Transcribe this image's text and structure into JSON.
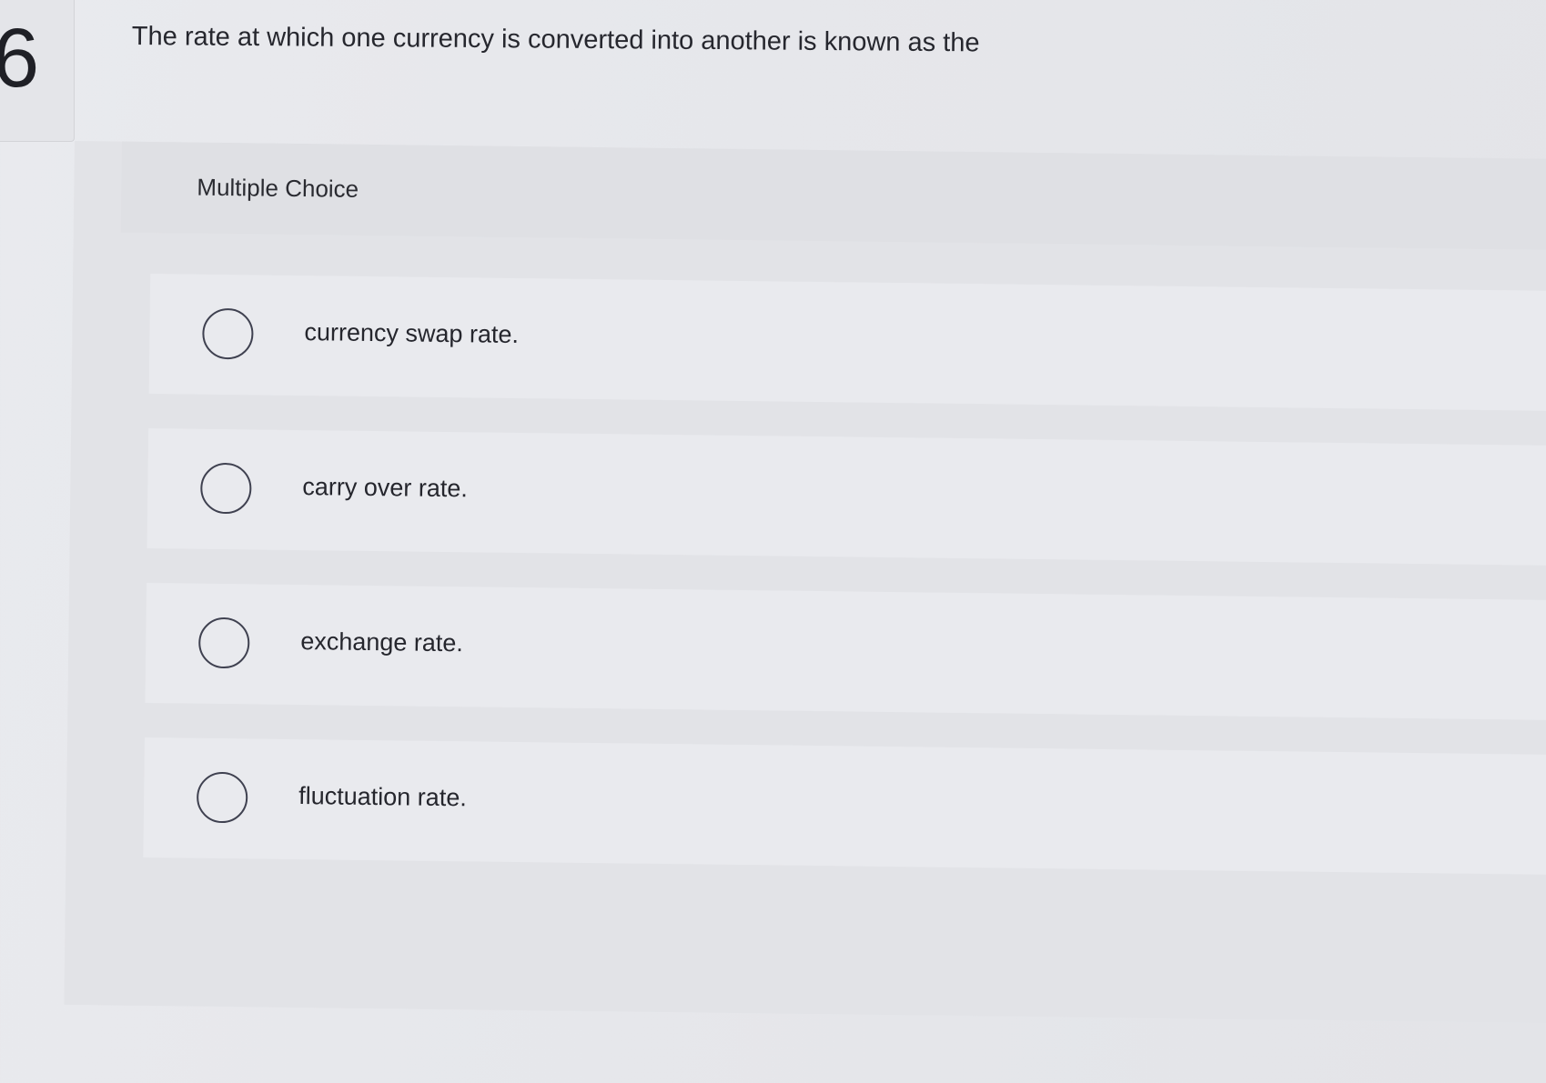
{
  "question": {
    "number": "6",
    "text": "The rate at which one currency is converted into another is known as the"
  },
  "multiple_choice": {
    "label": "Multiple Choice",
    "options": [
      {
        "label": "currency swap rate.",
        "selected": false
      },
      {
        "label": "carry over rate.",
        "selected": false
      },
      {
        "label": "exchange rate.",
        "selected": false
      },
      {
        "label": "fluctuation rate.",
        "selected": false
      }
    ]
  },
  "colors": {
    "background": "#e6e7eb",
    "option_background": "#e9eaee",
    "radio_border": "#3f4150",
    "text": "#26272e"
  }
}
